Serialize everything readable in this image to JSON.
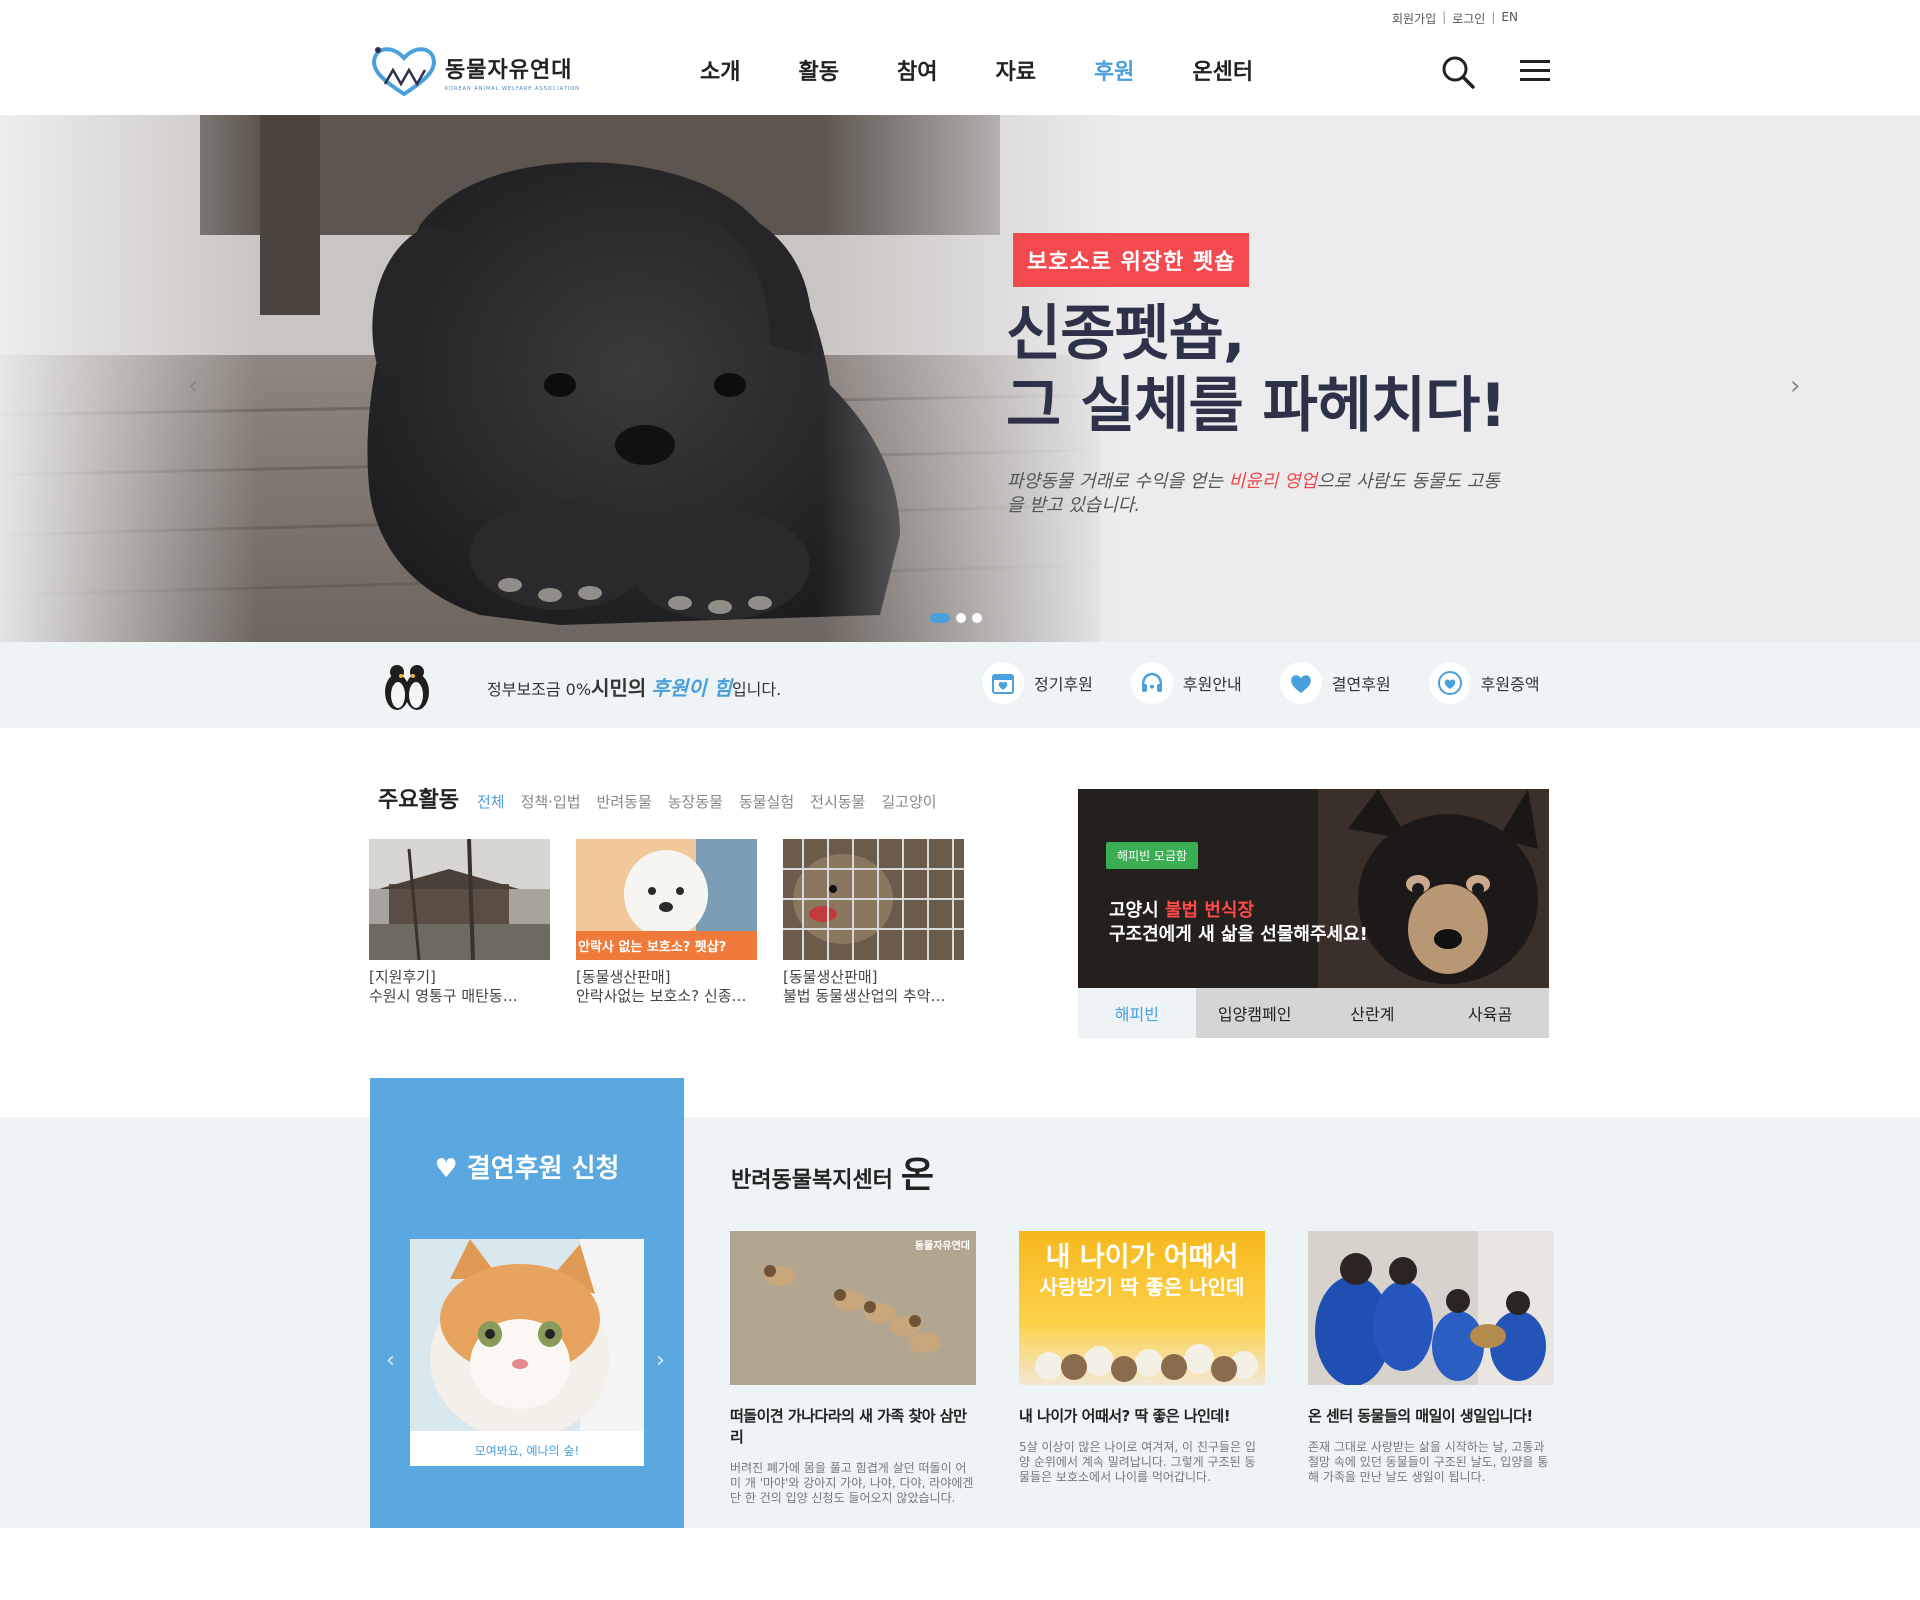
{
  "utility": {
    "join": "회원가입",
    "login": "로그인",
    "lang": "EN"
  },
  "logo": {
    "name": "동물자유연대",
    "sub": "KOREAN ANIMAL WELFARE ASSOCIATION"
  },
  "nav": [
    {
      "label": "소개",
      "active": false
    },
    {
      "label": "활동",
      "active": false
    },
    {
      "label": "참여",
      "active": false
    },
    {
      "label": "자료",
      "active": false
    },
    {
      "label": "후원",
      "active": true
    },
    {
      "label": "온센터",
      "active": false
    }
  ],
  "hero": {
    "tag": "보호소로 위장한 펫숍",
    "title_line1": "신종펫숍,",
    "title_line2": "그 실체를 파헤치다!",
    "desc_before": "파양동물 거래로 수익을 얻는 ",
    "desc_highlight": "비윤리 영업",
    "desc_after": "으로 사람도 동물도 고통을 받고 있습니다.",
    "slides": 3,
    "active_slide": 1
  },
  "support_bar": {
    "slogan_pre": "정부보조금 0%",
    "slogan_em1": "시민의",
    "slogan_em2": "후원이 힘",
    "slogan_post": "입니다.",
    "links": [
      {
        "label": "정기후원",
        "icon": "calendar-heart-icon"
      },
      {
        "label": "후원안내",
        "icon": "headset-icon"
      },
      {
        "label": "결연후원",
        "icon": "heart-icon"
      },
      {
        "label": "후원증액",
        "icon": "heart-circle-icon"
      }
    ]
  },
  "activities": {
    "title": "주요활동",
    "tabs": [
      "전체",
      "정책·입법",
      "반려동물",
      "농장동물",
      "동물실험",
      "전시동물",
      "길고양이"
    ],
    "active_tab": 0,
    "items": [
      {
        "category": "[지원후기]",
        "title": "수원시 영통구 매탄동…"
      },
      {
        "category": "[동물생산판매]",
        "title": "안락사없는 보호소? 신종…",
        "thumb_caption": "안락사 없는 보호소? 펫샵?"
      },
      {
        "category": "[동물생산판매]",
        "title": "불법 동물생산업의 추악…"
      }
    ]
  },
  "happybean": {
    "badge": "해피빈 모금함",
    "line1_pre": "고양시 ",
    "line1_red": "불법 번식장",
    "line2": "구조견에게 새 삶을 선물해주세요!",
    "tabs": [
      "해피빈",
      "입양캠페인",
      "산란계",
      "사육곰"
    ],
    "active_tab": 0
  },
  "sponsor": {
    "title": "♥ 결연후원 신청",
    "caption": "모여봐요, 예나의 숲!"
  },
  "on_center": {
    "title": "반려동물복지센터",
    "title_big": "온",
    "items": [
      {
        "title": "떠돌이견 가나다라의 새 가족 찾아 삼만리",
        "desc": "버려진 폐가에 몸을 풀고 힘겹게 살던 떠돌이 어미 개 '마야'와 강아지 가야, 나야, 다야, 라야에겐 단 한 건의 입양 신청도 들어오지 않았습니다.",
        "watermark": "동물자유연대"
      },
      {
        "title": "내 나이가 어때서? 딱 좋은 나인데!",
        "desc": "5살 이상이 많은 나이로 여겨져, 이 친구들은 입양 순위에서 계속 밀려납니다. 그렇게 구조된 동물들은 보호소에서 나이를 먹어갑니다.",
        "banner_line1": "내 나이가 어때서",
        "banner_line2": "사랑받기 딱 좋은 나인데"
      },
      {
        "title": "온 센터 동물들의 매일이 생일입니다!",
        "desc": "존재 그대로 사랑받는 삶을 시작하는 날, 고통과 절망 속에 있던 동물들이 구조된 날도, 입양을 통해 가족을 만난 날도 생일이 됩니다."
      }
    ]
  },
  "colors": {
    "accent": "#4aa0dc",
    "tag_red": "#f24a4f",
    "navy_title": "#2e3248",
    "light_bg": "#eef3f6",
    "sponsor_blue": "#5aa8df",
    "hb_green": "#3aae52"
  }
}
